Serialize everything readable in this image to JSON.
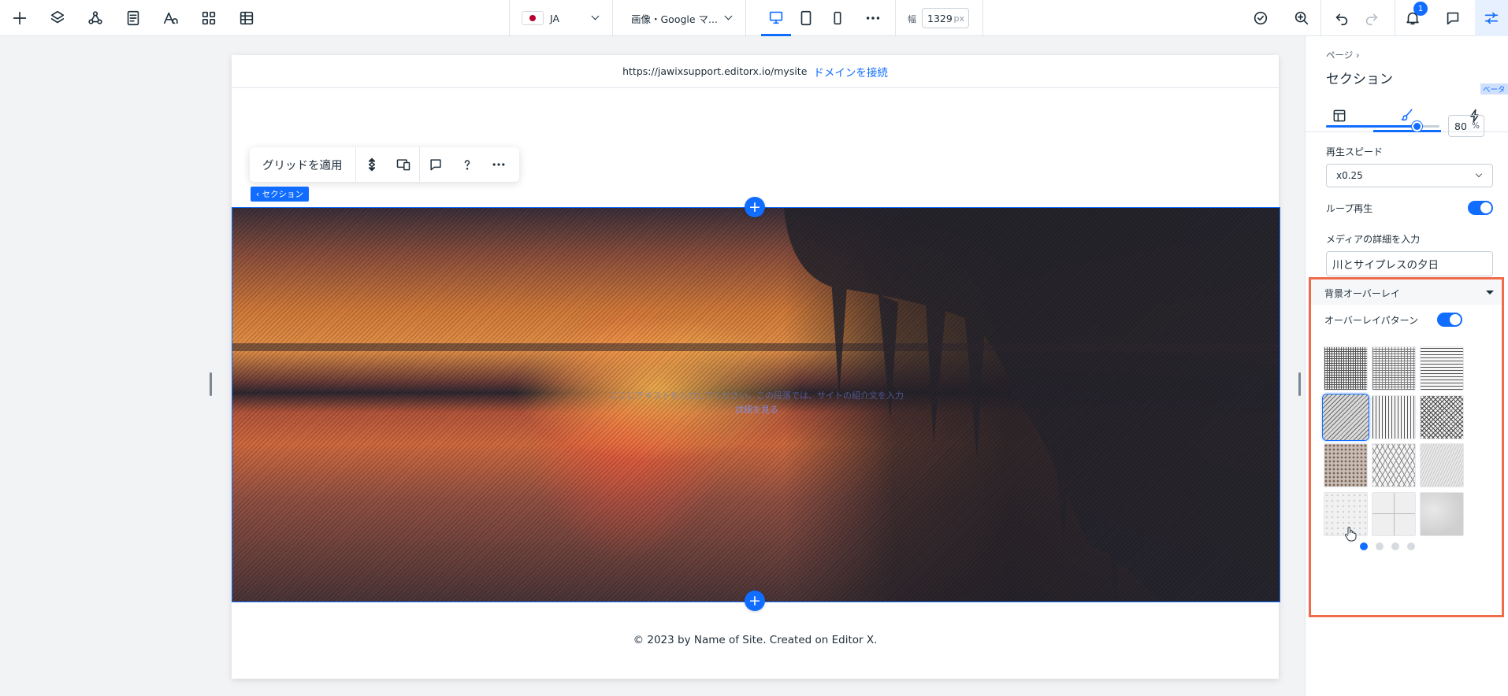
{
  "language": {
    "code": "JA"
  },
  "page_selector": {
    "label": "画像・Google マ..."
  },
  "width": {
    "label": "幅",
    "value": "1329",
    "unit": "px"
  },
  "notifications": {
    "count": "1"
  },
  "canvas": {
    "url": "https://jawixsupport.editorx.io/mysite",
    "connect_domain": "ドメインを接続",
    "toolbar": {
      "apply_grid": "グリッドを適用"
    },
    "section_tag": "‹ セクション",
    "hero_caption_line1": "ここにテキストを入力してください。この段落では、サイトの紹介文を入力",
    "hero_caption_line2": "詳細を見る",
    "footer": "© 2023 by Name of Site. Created on Editor X."
  },
  "inspector": {
    "breadcrumb": "ページ  ›",
    "title": "セクション",
    "beta_badge": "ベータ",
    "opacity": {
      "value": "80",
      "unit": "%",
      "fraction": 0.8
    },
    "playback_speed": {
      "label": "再生スピード",
      "value": "x0.25"
    },
    "loop": {
      "label": "ループ再生",
      "on": true
    },
    "media_details": {
      "label": "メディアの詳細を入力",
      "value": "川とサイプレスの夕日"
    },
    "overlay": {
      "header": "背景オーバーレイ",
      "pattern_toggle": {
        "label": "オーバーレイパターン",
        "on": true
      },
      "selected_pattern": 4,
      "pattern_page": 1,
      "pattern_pages": 4
    }
  },
  "colors": {
    "accent": "#116dff",
    "highlight_border": "#f06b4a"
  }
}
